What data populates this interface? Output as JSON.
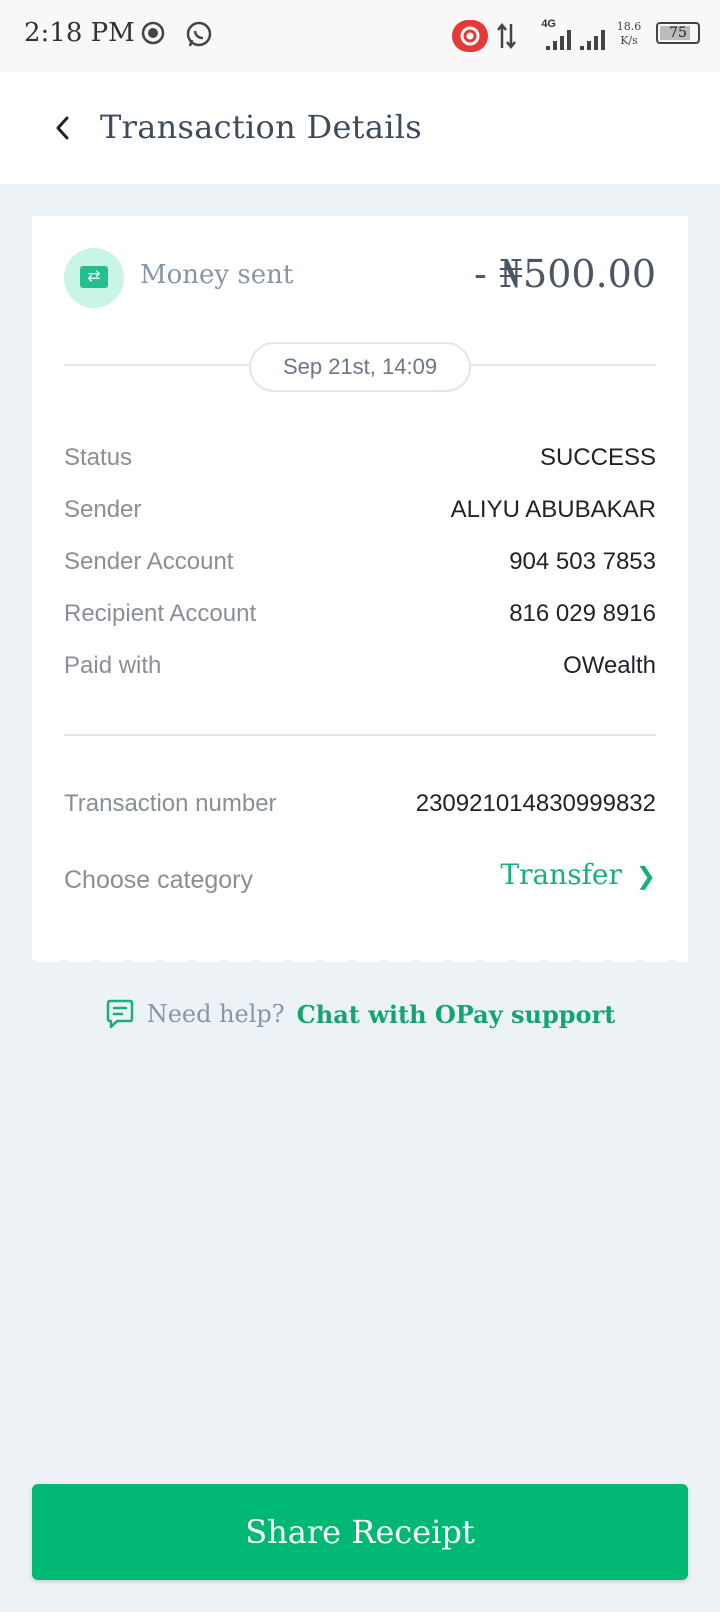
{
  "status_bar": {
    "time": "2:18 PM",
    "network": "4G",
    "speed_value": "18.6",
    "speed_unit": "K/s",
    "battery": "75"
  },
  "header": {
    "title": "Transaction Details",
    "back_icon": "chevron-left-icon"
  },
  "summary": {
    "label": "Money sent",
    "amount": "- ₦500.00",
    "date": "Sep 21st, 14:09"
  },
  "details": [
    {
      "label": "Status",
      "value": "SUCCESS"
    },
    {
      "label": "Sender",
      "value": "ALIYU ABUBAKAR"
    },
    {
      "label": "Sender Account",
      "value": "904 503 7853"
    },
    {
      "label": "Recipient Account",
      "value": "816 029 8916"
    },
    {
      "label": "Paid with",
      "value": "OWealth"
    }
  ],
  "transaction_number": {
    "label": "Transaction number",
    "value": "230921014830999832"
  },
  "category": {
    "label": "Choose category",
    "value": "Transfer"
  },
  "help": {
    "text": "Need help?",
    "link": "Chat with OPay support"
  },
  "share_button": "Share Receipt",
  "colors": {
    "accent": "#00b874",
    "accent_text": "#13a571",
    "background": "#edf2f7",
    "icon_bg": "#c8f5e8"
  }
}
